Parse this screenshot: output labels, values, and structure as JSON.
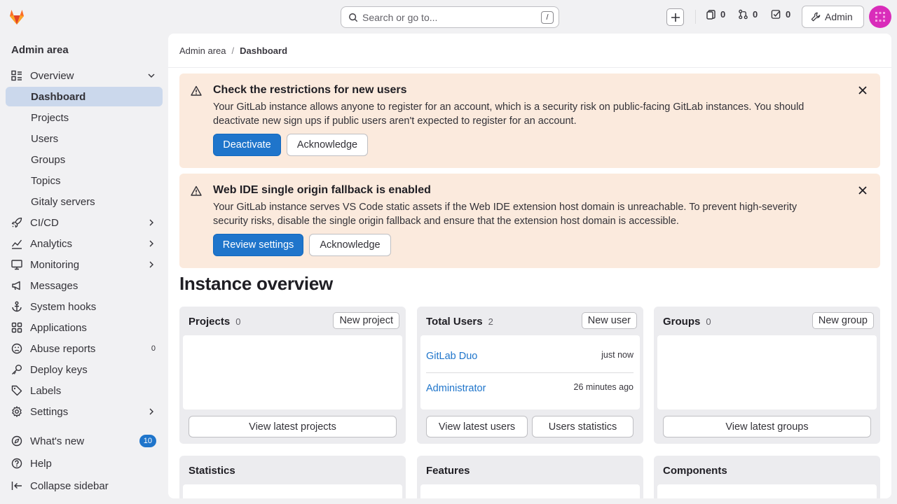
{
  "topbar": {
    "search_placeholder": "Search or go to...",
    "search_shortcut": "/",
    "issues_count": "0",
    "merge_requests_count": "0",
    "todos_count": "0",
    "admin_label": "Admin"
  },
  "sidebar": {
    "title": "Admin area",
    "overview_label": "Overview",
    "overview_items": [
      "Dashboard",
      "Projects",
      "Users",
      "Groups",
      "Topics",
      "Gitaly servers"
    ],
    "items": [
      {
        "label": "CI/CD"
      },
      {
        "label": "Analytics"
      },
      {
        "label": "Monitoring"
      },
      {
        "label": "Messages"
      },
      {
        "label": "System hooks"
      },
      {
        "label": "Applications"
      },
      {
        "label": "Abuse reports",
        "badge": "0"
      },
      {
        "label": "Deploy keys"
      },
      {
        "label": "Labels"
      },
      {
        "label": "Settings"
      }
    ],
    "whats_new": "What's new",
    "whats_new_count": "10",
    "help": "Help",
    "collapse": "Collapse sidebar"
  },
  "breadcrumb": {
    "root": "Admin area",
    "sep": "/",
    "current": "Dashboard"
  },
  "alerts": [
    {
      "title": "Check the restrictions for new users",
      "line1": "Your GitLab instance allows anyone to register for an account, which is a security risk on public-facing GitLab instances. You should",
      "line2": "deactivate new sign ups if public users aren't expected to register for an account.",
      "primary": "Deactivate",
      "secondary": "Acknowledge"
    },
    {
      "title": "Web IDE single origin fallback is enabled",
      "line1": "Your GitLab instance serves VS Code static assets if the Web IDE extension host domain is unreachable. To prevent high-severity",
      "line2": "security risks, disable the single origin fallback and ensure that the extension host domain is accessible.",
      "primary": "Review settings",
      "secondary": "Acknowledge"
    }
  ],
  "heading": "Instance overview",
  "cards": {
    "projects": {
      "title": "Projects",
      "count": "0",
      "action": "New project",
      "footer": "View latest projects"
    },
    "users": {
      "title": "Total Users",
      "count": "2",
      "action": "New user",
      "rows": [
        {
          "name": "GitLab Duo",
          "time": "just now"
        },
        {
          "name": "Administrator",
          "time": "26 minutes ago"
        }
      ],
      "footer1": "View latest users",
      "footer2": "Users statistics"
    },
    "groups": {
      "title": "Groups",
      "count": "0",
      "action": "New group",
      "footer": "View latest groups"
    }
  },
  "bottom_cards": [
    "Statistics",
    "Features",
    "Components"
  ]
}
